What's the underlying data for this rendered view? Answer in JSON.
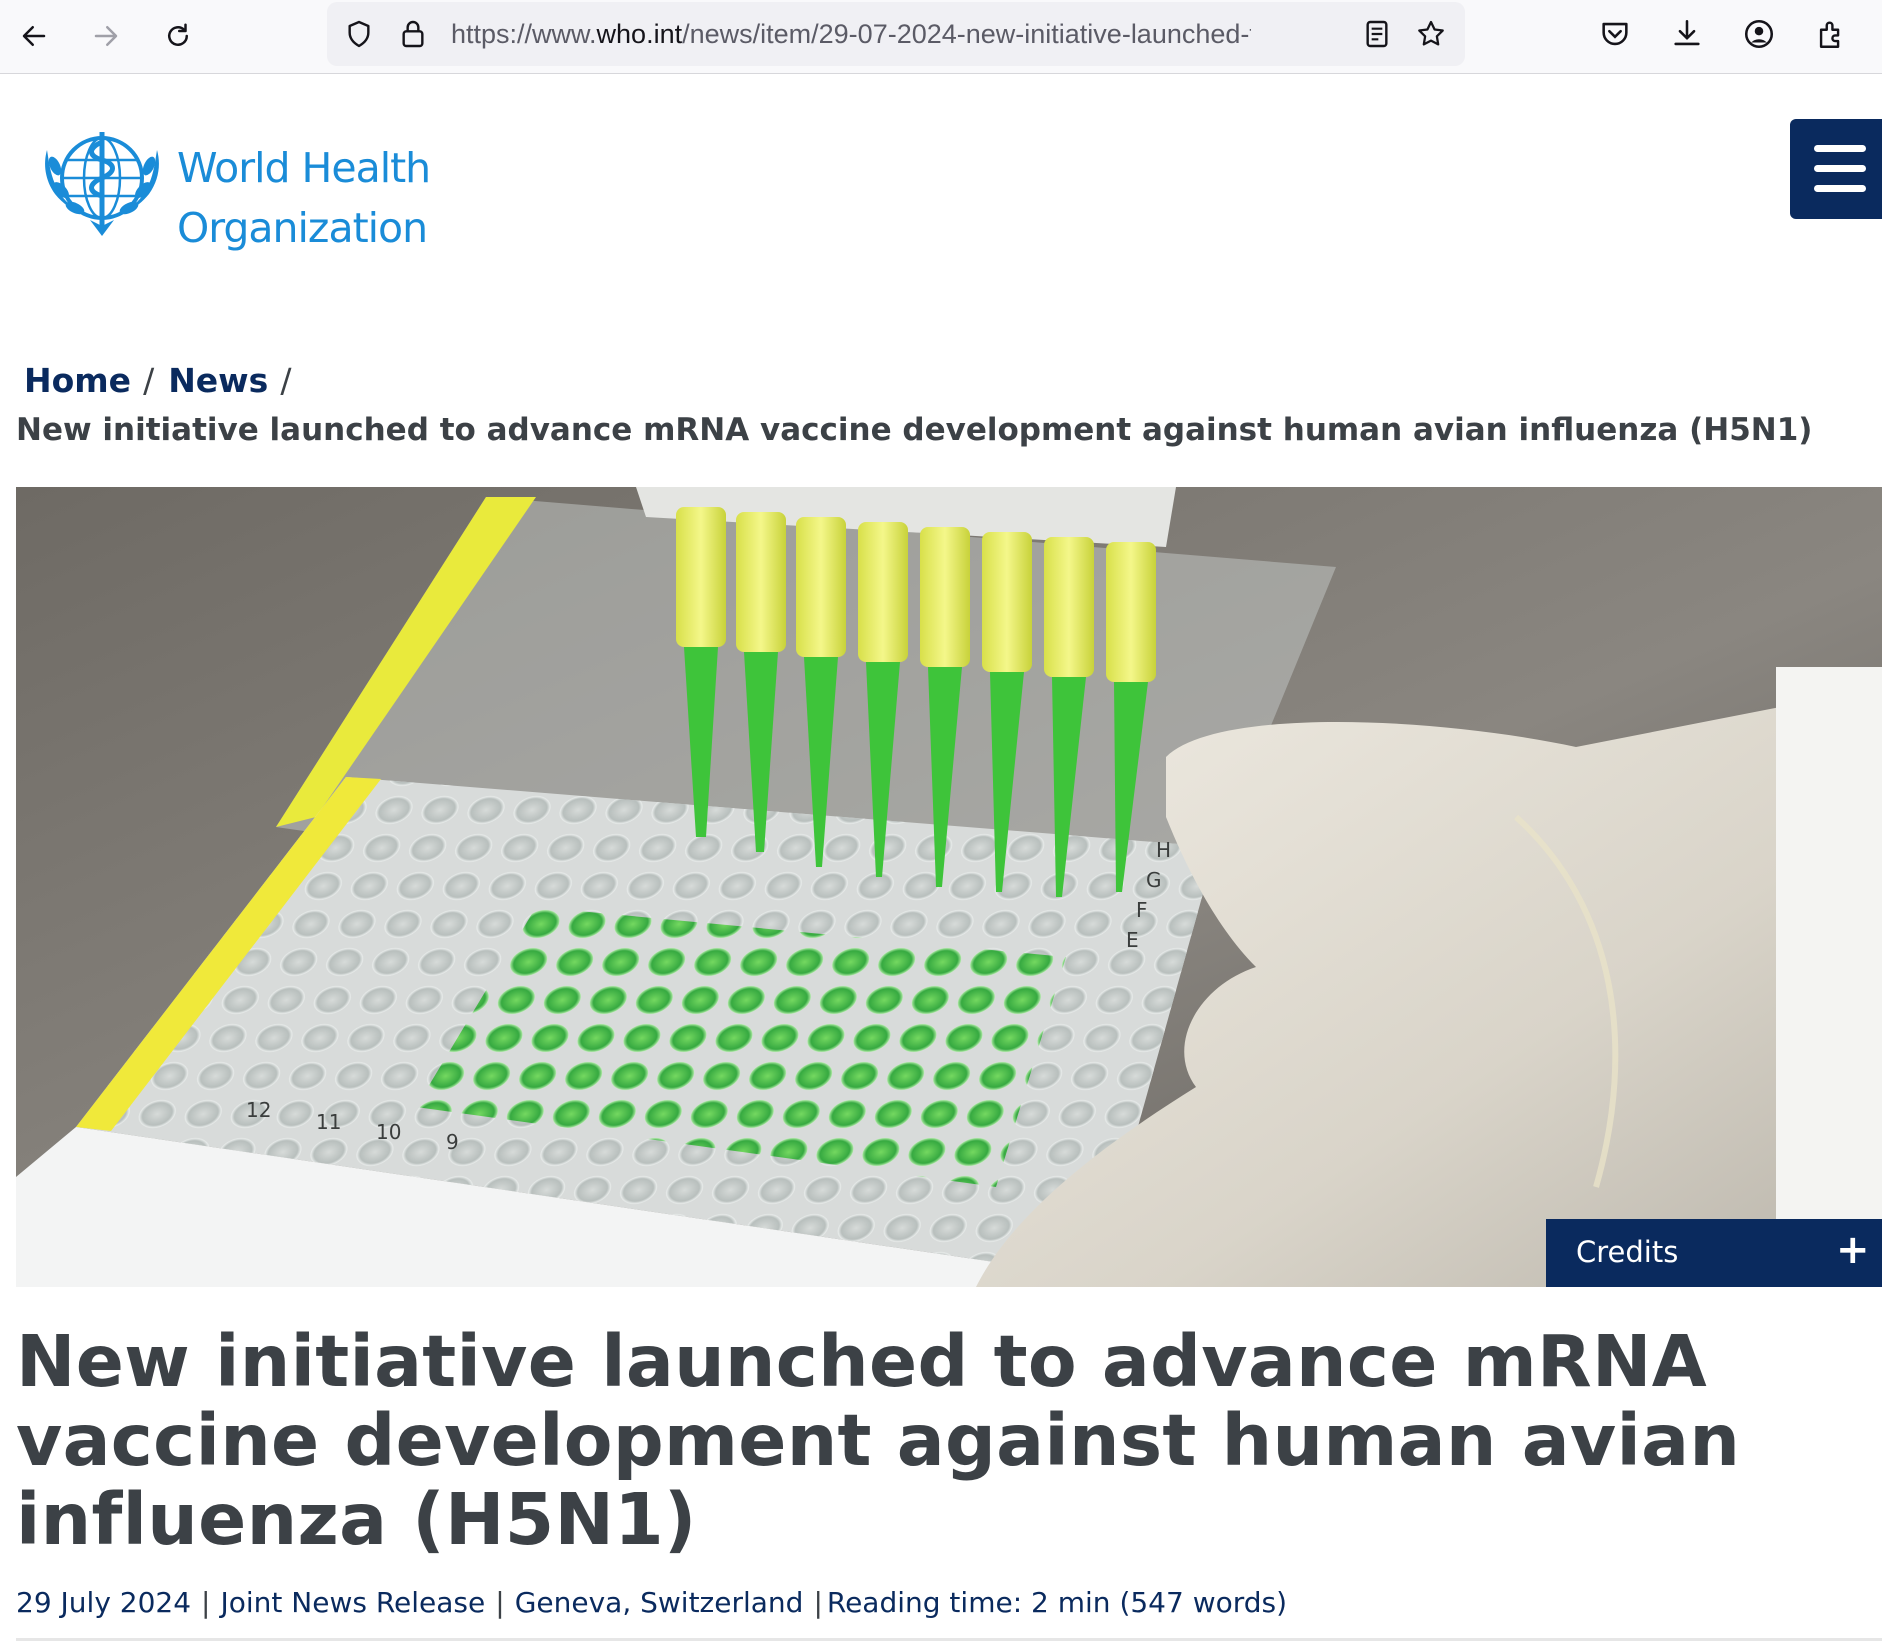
{
  "browser": {
    "url_prefix": "https://www.",
    "url_domain": "who.int",
    "url_path": "/news/item/29-07-2024-new-initiative-launched-to",
    "icons": [
      "back-icon",
      "forward-icon",
      "reload-icon",
      "shield-icon",
      "lock-icon",
      "reader-view-icon",
      "bookmark-star-icon",
      "pocket-icon",
      "download-icon",
      "account-icon",
      "extensions-icon"
    ]
  },
  "site": {
    "logo_line1": "World Health",
    "logo_line2": "Organization",
    "brand_color": "#1a8cd8",
    "nav_color": "#0a2a5e"
  },
  "breadcrumb": {
    "home": "Home",
    "news": "News",
    "separator": "/",
    "current": "New initiative launched to advance mRNA vaccine development against human avian influenza (H5N1)"
  },
  "hero": {
    "credits_label": "Credits",
    "credits_toggle": "+",
    "plate_row_letters": [
      "H",
      "G",
      "F",
      "E"
    ],
    "plate_col_numbers": [
      "12",
      "11",
      "10",
      "9"
    ]
  },
  "article": {
    "title": "New initiative launched to advance mRNA vaccine development against human avian influenza (H5N1)",
    "date": "29 July 2024",
    "type": "Joint News Release",
    "location": "Geneva, Switzerland",
    "pipe": "|",
    "reading_time": "Reading time: 2 min (547 words)"
  }
}
